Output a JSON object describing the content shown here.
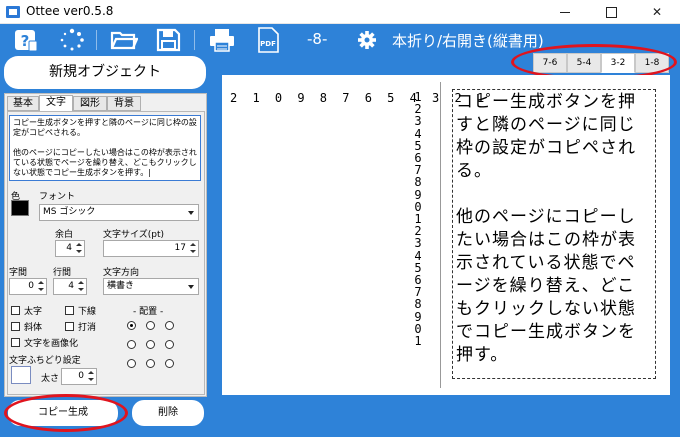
{
  "window": {
    "title": "Ottee ver0.5.8"
  },
  "toolbar": {
    "page_indicator": "-8-",
    "layout_label": "本折り/右開き(縦書用)"
  },
  "page_tabs": [
    {
      "label": "7-6",
      "active": false
    },
    {
      "label": "5-4",
      "active": false
    },
    {
      "label": "3-2",
      "active": true
    },
    {
      "label": "1-8",
      "active": false
    }
  ],
  "left_panel": {
    "new_object_label": "新規オブジェクト",
    "tabs": [
      {
        "label": "基本",
        "active": false
      },
      {
        "label": "文字",
        "active": true
      },
      {
        "label": "図形",
        "active": false
      },
      {
        "label": "背景",
        "active": false
      }
    ],
    "text_content": "コピー生成ボタンを押すと隣のページに同じ枠の設定がコピペされる。\n\n他のページにコピーしたい場合はこの枠が表示されている状態でページを繰り替え、どこもクリックしない状態でコピー生成ボタンを押す。|",
    "color_label": "色",
    "color_value": "#000000",
    "font_label": "フォント",
    "font_value": "MS ゴシック",
    "margin_label": "余白",
    "margin_value": "4",
    "font_size_label": "文字サイズ(pt)",
    "font_size_value": "17",
    "char_spacing_label": "字間",
    "char_spacing_value": "0",
    "line_spacing_label": "行間",
    "line_spacing_value": "4",
    "direction_label": "文字方向",
    "direction_value": "横書き",
    "bold_label": "太字",
    "underline_label": "下線",
    "italic_label": "斜体",
    "strike_label": "打消",
    "to_image_label": "文字を画像化",
    "alignment_label": "- 配置 -",
    "outline_label": "文字ふちどり設定",
    "thickness_label": "太さ",
    "thickness_value": "0",
    "copy_button_label": "コピー生成",
    "delete_button_label": "削除"
  },
  "canvas": {
    "column_numbers_h": "2 1 0 9 8 7 6 5 4 3 2 1",
    "row_numbers": [
      "1",
      "2",
      "3",
      "4",
      "5",
      "6",
      "7",
      "8",
      "9",
      "0",
      "1",
      "2",
      "3",
      "4",
      "5",
      "6",
      "7",
      "8",
      "9",
      "0",
      "1"
    ],
    "paragraph_1": "コピー生成ボタンを押すと隣のページに同じ枠の設定がコピペされる。",
    "paragraph_2": "他のページにコピーしたい場合はこの枠が表示されている状態でページを繰り替え、どこもクリックしない状態でコピー生成ボタンを押す。"
  },
  "colors": {
    "accent": "#2e82d8",
    "highlight_circle": "#e0141e"
  }
}
